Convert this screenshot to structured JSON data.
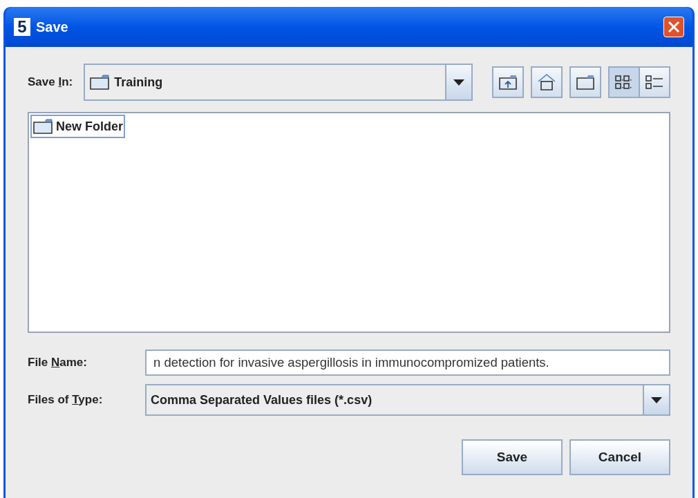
{
  "window": {
    "title": "Save",
    "icon_text": "5"
  },
  "save_in": {
    "label": [
      "Save ",
      "I",
      "n:"
    ],
    "value": "Training"
  },
  "toolbar": [
    {
      "kind": "up",
      "selected": false
    },
    {
      "kind": "home",
      "selected": false
    },
    {
      "kind": "new-folder",
      "selected": false
    },
    {
      "kind": "list",
      "selected": true
    },
    {
      "kind": "details",
      "selected": false
    }
  ],
  "files": [
    {
      "name": "New Folder",
      "selected": true
    }
  ],
  "file_name": {
    "label": [
      "File ",
      "N",
      "ame:"
    ],
    "value": "n detection for invasive aspergillosis in immunocompromized patients."
  },
  "file_type": {
    "label": [
      "Files of ",
      "T",
      "ype:"
    ],
    "value": "Comma Separated Values files (*.csv)"
  },
  "buttons": [
    "Save",
    "Cancel"
  ]
}
